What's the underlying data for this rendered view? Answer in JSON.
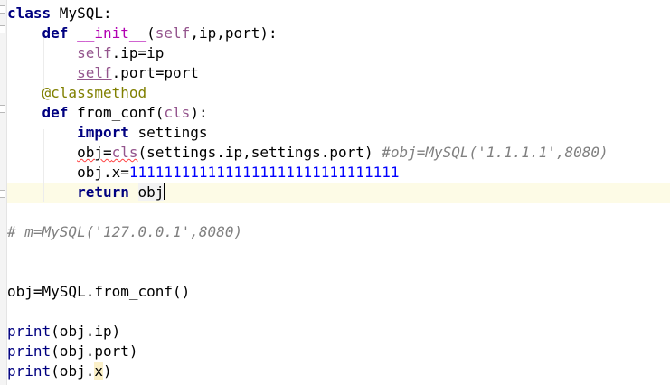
{
  "code": {
    "l1": {
      "kw": "class",
      "name": " MySQL:"
    },
    "l2": {
      "indent": "    ",
      "kw": "def",
      "sp": " ",
      "fn": "__init__",
      "p1": "(",
      "self": "self",
      "rest": ",ip,port):"
    },
    "l3": {
      "indent": "        ",
      "self": "self",
      "rest": ".ip=ip"
    },
    "l4": {
      "indent": "        ",
      "self": "self",
      "rest": ".port=port"
    },
    "l5": {
      "indent": "    ",
      "deco": "@classmethod"
    },
    "l6": {
      "indent": "    ",
      "kw": "def",
      "rest1": " from_conf(",
      "param": "cls",
      "rest2": "):"
    },
    "l7": {
      "indent": "        ",
      "kw": "import",
      "rest": " settings"
    },
    "l8": {
      "indent": "        ",
      "a": "obj=",
      "cls": "cls",
      "b": "(settings.ip,settings.port) ",
      "comment": "#obj=MySQL('1.1.1.1',8080)"
    },
    "l9": {
      "indent": "        ",
      "a": "obj.x=",
      "num": "1111111111111111111111111111111"
    },
    "l10": {
      "indent": "        ",
      "kw": "return",
      "sp": " ",
      "obj": "obj"
    },
    "l12": {
      "comment": "# m=MySQL('127.0.0.1',8080)"
    },
    "l15": {
      "text": "obj=MySQL.from_conf()"
    },
    "l17": {
      "fn": "print",
      "rest": "(obj.ip)"
    },
    "l18": {
      "fn": "print",
      "rest": "(obj.port)"
    },
    "l19": {
      "fn": "print",
      "rest1": "(obj.",
      "x": "x",
      "rest2": ")"
    }
  }
}
